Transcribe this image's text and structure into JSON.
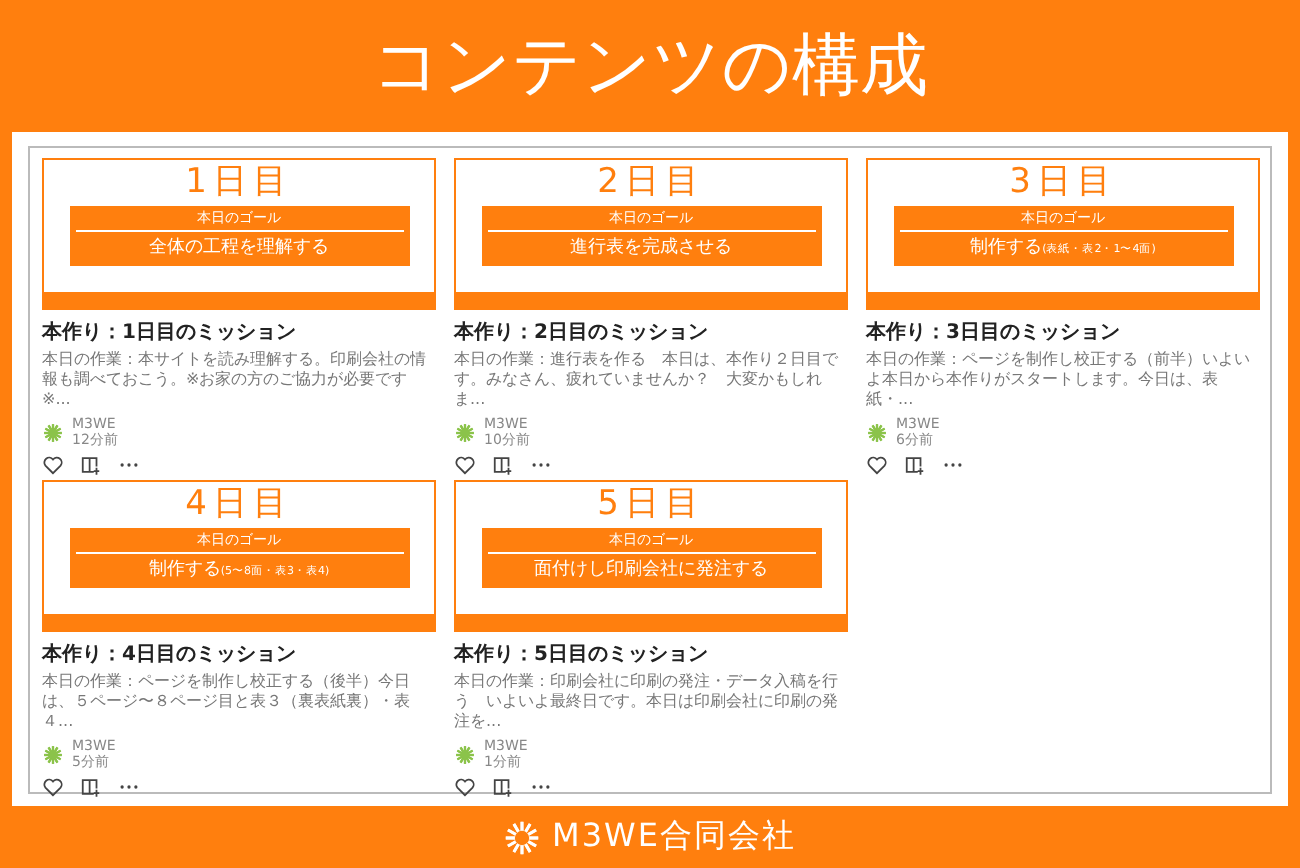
{
  "title": "コンテンツの構成",
  "cards": [
    {
      "day": "1日目",
      "goal_label": "本日のゴール",
      "goal": "全体の工程を理解する",
      "title": "本作り：1日目のミッション",
      "excerpt": "本日の作業：本サイトを読み理解する。印刷会社の情報も調べておこう。※お家の方のご協力が必要です※...",
      "author": "M3WE",
      "time": "12分前"
    },
    {
      "day": "2日目",
      "goal_label": "本日のゴール",
      "goal": "進行表を完成させる",
      "title": "本作り：2日目のミッション",
      "excerpt": "本日の作業：進行表を作る　本日は、本作り２日目です。みなさん、疲れていませんか？　大変かもしれま...",
      "author": "M3WE",
      "time": "10分前"
    },
    {
      "day": "3日目",
      "goal_label": "本日のゴール",
      "goal": "制作する",
      "goal_note": "(表紙・表2・1〜4面)",
      "title": "本作り：3日目のミッション",
      "excerpt": "本日の作業：ページを制作し校正する（前半）いよいよ本日から本作りがスタートします。今日は、表紙・...",
      "author": "M3WE",
      "time": "6分前"
    },
    {
      "day": "4日目",
      "goal_label": "本日のゴール",
      "goal": "制作する",
      "goal_note": "(5〜8面・表3・表4)",
      "title": "本作り：4日目のミッション",
      "excerpt": "本日の作業：ページを制作し校正する（後半）今日は、５ページ〜８ページ目と表３（裏表紙裏）・表４...",
      "author": "M3WE",
      "time": "5分前"
    },
    {
      "day": "5日目",
      "goal_label": "本日のゴール",
      "goal": "面付けし印刷会社に発注する",
      "title": "本作り：5日目のミッション",
      "excerpt": "本日の作業：印刷会社に印刷の発注・データ入稿を行う　いよいよ最終日です。本日は印刷会社に印刷の発注を...",
      "author": "M3WE",
      "time": "1分前"
    }
  ],
  "footer": {
    "company": "M3WE合同会社"
  }
}
